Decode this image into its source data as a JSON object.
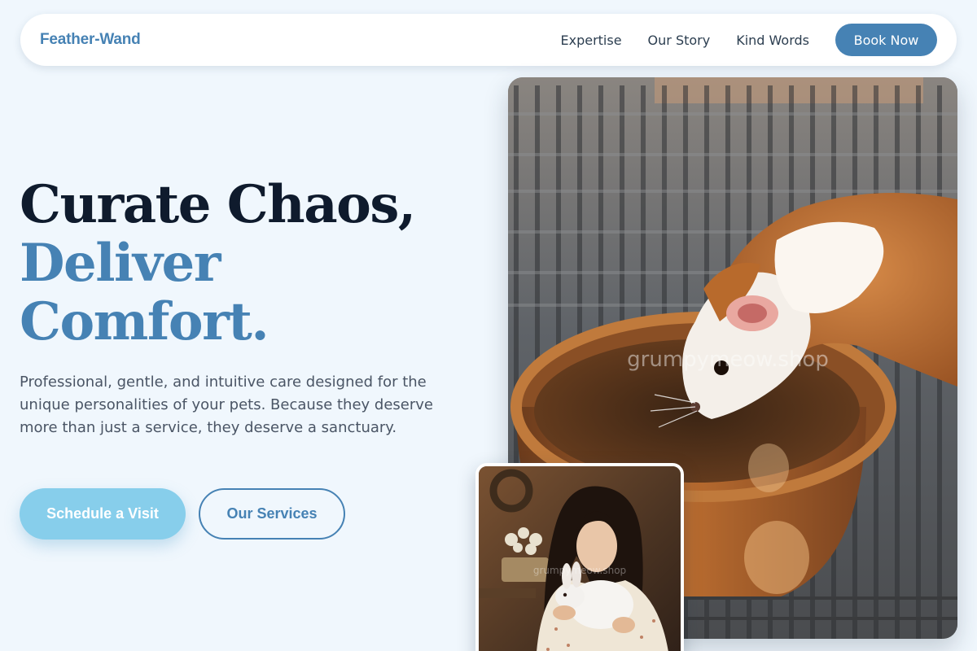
{
  "header": {
    "brand": "Feather-Wand",
    "nav": [
      {
        "label": "Expertise"
      },
      {
        "label": "Our Story"
      },
      {
        "label": "Kind Words"
      }
    ],
    "cta_label": "Book Now"
  },
  "hero": {
    "headline_line1": "Curate Chaos,",
    "headline_line2": "Deliver",
    "headline_line3": "Comfort.",
    "lede": "Professional, gentle, and intuitive care designed for the unique personalities of your pets. Because they deserve more than just a service, they deserve a sanctuary.",
    "primary_button": "Schedule a Visit",
    "secondary_button": "Our Services"
  },
  "images": {
    "main_watermark": "grumpymeow.shop",
    "small_watermark": "grumpymeow.shop"
  },
  "colors": {
    "background": "#f0f7fd",
    "accent": "#4682b4",
    "sky": "#87ceeb",
    "ink": "#0f1b2d"
  }
}
